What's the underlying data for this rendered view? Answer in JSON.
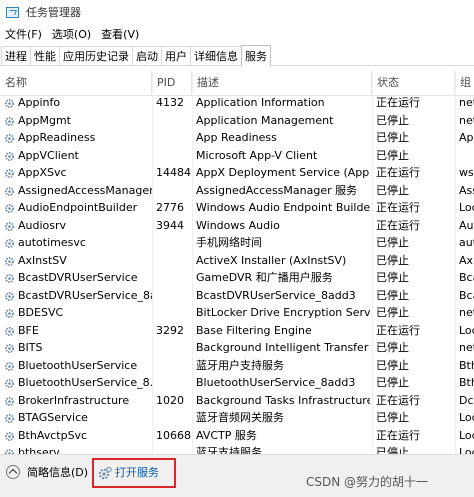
{
  "window": {
    "title": "任务管理器"
  },
  "menu": [
    "文件(F)",
    "选项(O)",
    "查看(V)"
  ],
  "tabs": [
    {
      "label": "进程",
      "active": false
    },
    {
      "label": "性能",
      "active": false
    },
    {
      "label": "应用历史记录",
      "active": false
    },
    {
      "label": "启动",
      "active": false
    },
    {
      "label": "用户",
      "active": false
    },
    {
      "label": "详细信息",
      "active": false
    },
    {
      "label": "服务",
      "active": true
    }
  ],
  "columns": {
    "name": "名称",
    "pid": "PID",
    "desc": "描述",
    "status": "状态",
    "group": "组"
  },
  "services": [
    {
      "name": "Appinfo",
      "pid": "4132",
      "desc": "Application Information",
      "status": "正在运行",
      "group": "net"
    },
    {
      "name": "AppMgmt",
      "pid": "",
      "desc": "Application Management",
      "status": "已停止",
      "group": "net"
    },
    {
      "name": "AppReadiness",
      "pid": "",
      "desc": "App Readiness",
      "status": "已停止",
      "group": "App"
    },
    {
      "name": "AppVClient",
      "pid": "",
      "desc": "Microsoft App-V Client",
      "status": "已停止",
      "group": ""
    },
    {
      "name": "AppXSvc",
      "pid": "14484",
      "desc": "AppX Deployment Service (AppX...",
      "status": "正在运行",
      "group": "wsa"
    },
    {
      "name": "AssignedAccessManager...",
      "pid": "",
      "desc": "AssignedAccessManager 服务",
      "status": "已停止",
      "group": "Ass"
    },
    {
      "name": "AudioEndpointBuilder",
      "pid": "2776",
      "desc": "Windows Audio Endpoint Builder",
      "status": "正在运行",
      "group": "Loc"
    },
    {
      "name": "Audiosrv",
      "pid": "3944",
      "desc": "Windows Audio",
      "status": "正在运行",
      "group": "Aud"
    },
    {
      "name": "autotimesvc",
      "pid": "",
      "desc": "手机网络时间",
      "status": "已停止",
      "group": "aut"
    },
    {
      "name": "AxInstSV",
      "pid": "",
      "desc": "ActiveX Installer (AxInstSV)",
      "status": "已停止",
      "group": "Axl"
    },
    {
      "name": "BcastDVRUserService",
      "pid": "",
      "desc": "GameDVR 和广播用户服务",
      "status": "已停止",
      "group": "Bca"
    },
    {
      "name": "BcastDVRUserService_8a...",
      "pid": "",
      "desc": "BcastDVRUserService_8add3",
      "status": "已停止",
      "group": "Bca"
    },
    {
      "name": "BDESVC",
      "pid": "",
      "desc": "BitLocker Drive Encryption Service",
      "status": "已停止",
      "group": "net"
    },
    {
      "name": "BFE",
      "pid": "3292",
      "desc": "Base Filtering Engine",
      "status": "正在运行",
      "group": "Loc"
    },
    {
      "name": "BITS",
      "pid": "",
      "desc": "Background Intelligent Transfer ...",
      "status": "已停止",
      "group": "net"
    },
    {
      "name": "BluetoothUserService",
      "pid": "",
      "desc": "蓝牙用户支持服务",
      "status": "已停止",
      "group": "Bth"
    },
    {
      "name": "BluetoothUserService_8...",
      "pid": "",
      "desc": "BluetoothUserService_8add3",
      "status": "已停止",
      "group": "Bth"
    },
    {
      "name": "BrokerInfrastructure",
      "pid": "1020",
      "desc": "Background Tasks Infrastructure...",
      "status": "正在运行",
      "group": "Dco"
    },
    {
      "name": "BTAGService",
      "pid": "",
      "desc": "蓝牙音频网关服务",
      "status": "已停止",
      "group": "Loc"
    },
    {
      "name": "BthAvctpSvc",
      "pid": "10668",
      "desc": "AVCTP 服务",
      "status": "正在运行",
      "group": "Loc"
    },
    {
      "name": "bthserv",
      "pid": "",
      "desc": "蓝牙支持服务",
      "status": "已停止",
      "group": "Loc"
    }
  ],
  "footer": {
    "brief_label": "简略信息(D)",
    "open_services_label": "打开服务",
    "watermark": "CSDN @努力的胡十一"
  },
  "colors": {
    "highlight_border": "#d9262c",
    "link": "#0b5cad"
  }
}
